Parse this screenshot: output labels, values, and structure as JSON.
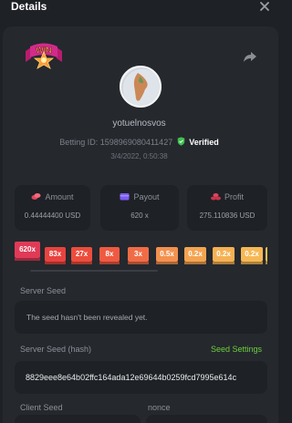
{
  "header": {
    "title": "Details"
  },
  "bet": {
    "username": "yotuelnosvos",
    "betting_id_label": "Betting ID:",
    "betting_id": "1598969080411427",
    "verified_label": "Verified",
    "date": "3/4/2022, 0:50:38"
  },
  "stats": [
    {
      "label": "Amount",
      "value": "0.44444400 USD",
      "icon": "coins-icon"
    },
    {
      "label": "Payout",
      "value": "620 x",
      "icon": "wallet-icon"
    },
    {
      "label": "Profit",
      "value": "275.110836 USD",
      "icon": "coins-icon"
    }
  ],
  "multipliers": [
    {
      "label": "620x",
      "color": "#e03a57"
    },
    {
      "label": "83x",
      "color": "#e8433f"
    },
    {
      "label": "27x",
      "color": "#ec4d3d"
    },
    {
      "label": "8x",
      "color": "#ef5a41"
    },
    {
      "label": "3x",
      "color": "#f06c47"
    },
    {
      "label": "0.5x",
      "color": "#f3914f"
    },
    {
      "label": "0.2x",
      "color": "#f4a451"
    },
    {
      "label": "0.2x",
      "color": "#f5b154"
    },
    {
      "label": "0.2x",
      "color": "#f5b856"
    },
    {
      "label": "",
      "color": "#f6be57"
    }
  ],
  "server_seed": {
    "label": "Server Seed",
    "value": "The seed hasn't been revealed yet."
  },
  "server_seed_hash": {
    "label": "Server Seed (hash)",
    "link": "Seed Settings",
    "value": "8829eee8e64b02ffc164ada12e69644b0259fcd7995e614c"
  },
  "client_seed": {
    "label": "Client Seed"
  },
  "nonce": {
    "label": "nonce"
  },
  "colors": {
    "background": "#1e2125",
    "panel": "#25282d",
    "accent_green": "#6ccf3e"
  }
}
